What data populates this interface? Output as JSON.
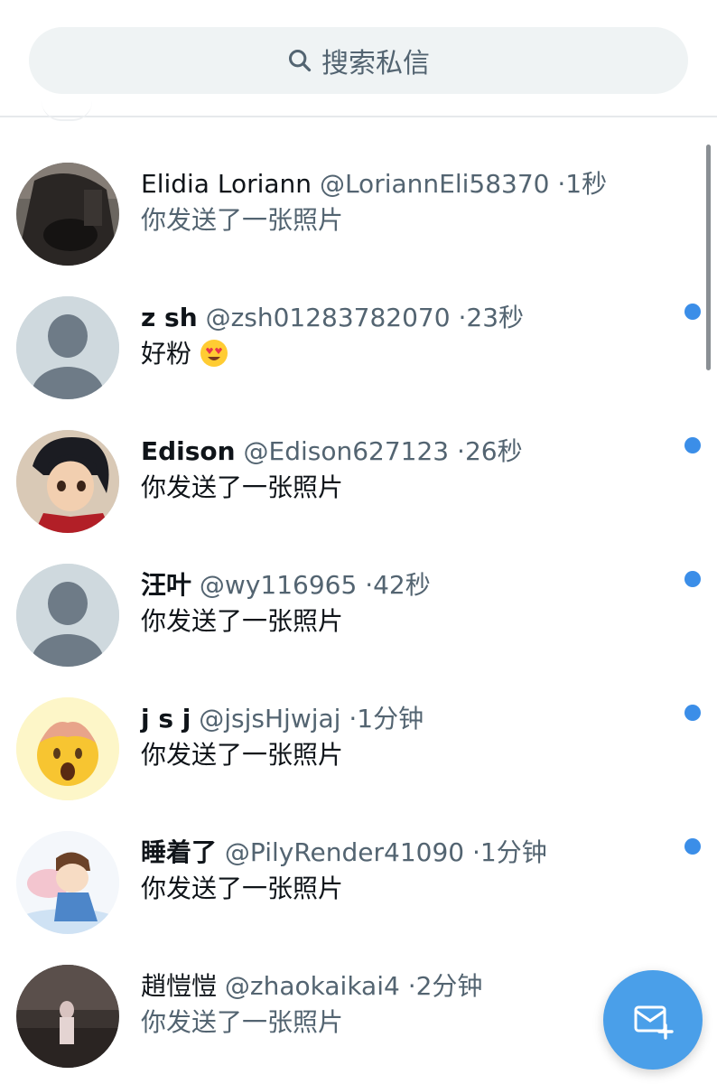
{
  "search": {
    "placeholder": "搜索私信"
  },
  "conversations": [
    {
      "name": "Elidia Loriann",
      "handle": "@LoriannEli58370",
      "time": "1秒",
      "message": "你发送了一张照片",
      "unread": false
    },
    {
      "name": "z sh",
      "handle": "@zsh01283782070",
      "time": "23秒",
      "message": "好粉",
      "emoji": "heart-eyes-emoji",
      "unread": true
    },
    {
      "name": "Edison",
      "handle": "@Edison627123",
      "time": "26秒",
      "message": "你发送了一张照片",
      "unread": true
    },
    {
      "name": "汪叶",
      "handle": "@wy116965",
      "time": "42秒",
      "message": "你发送了一张照片",
      "unread": true
    },
    {
      "name": "j s j",
      "handle": "@jsjsHjwjaj",
      "time": "1分钟",
      "message": "你发送了一张照片",
      "unread": true
    },
    {
      "name": "睡着了",
      "handle": "@PilyRender41090",
      "time": "1分钟",
      "message": "你发送了一张照片",
      "unread": true
    },
    {
      "name": "趙愷愷",
      "handle": "@zhaokaikai4",
      "time": "2分钟",
      "message": "你发送了一张照片",
      "unread": false
    }
  ],
  "separator": "·",
  "colors": {
    "accent": "#4a9fe9",
    "unread_dot": "#3b8ee8",
    "muted": "#536471"
  },
  "icons": {
    "search": "search-icon",
    "compose": "new-message-icon"
  }
}
